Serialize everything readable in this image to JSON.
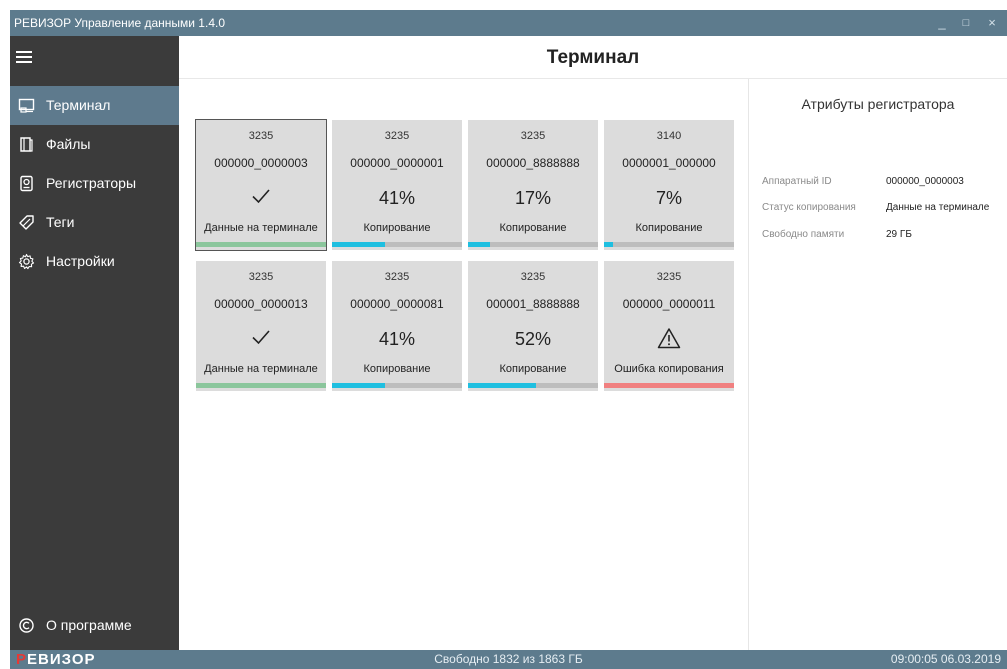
{
  "window": {
    "title": "РЕВИЗОР Управление данными 1.4.0",
    "controls": [
      "_",
      "□",
      "×"
    ]
  },
  "sidebar": {
    "items": [
      {
        "label": "Терминал",
        "icon": "terminal-icon",
        "active": true
      },
      {
        "label": "Файлы",
        "icon": "files-icon",
        "active": false
      },
      {
        "label": "Регистраторы",
        "icon": "recorder-icon",
        "active": false
      },
      {
        "label": "Теги",
        "icon": "tag-icon",
        "active": false
      },
      {
        "label": "Настройки",
        "icon": "gear-icon",
        "active": false
      }
    ],
    "about": {
      "label": "О программе",
      "icon": "copyright-icon"
    }
  },
  "header": {
    "title": "Терминал"
  },
  "devices": [
    {
      "number": "3235",
      "id": "000000_0000003",
      "progress_text": "",
      "indicator": "check-icon",
      "status": "Данные на терминале",
      "progress": 1.0,
      "bar_color": "#8bc69c",
      "selected": true
    },
    {
      "number": "3235",
      "id": "000000_0000001",
      "progress_text": "41%",
      "indicator": "",
      "status": "Копирование",
      "progress": 0.41,
      "bar_color": "#1fbfe0",
      "selected": false
    },
    {
      "number": "3235",
      "id": "000000_8888888",
      "progress_text": "17%",
      "indicator": "",
      "status": "Копирование",
      "progress": 0.17,
      "bar_color": "#1fbfe0",
      "selected": false
    },
    {
      "number": "3140",
      "id": "0000001_000000",
      "progress_text": "7%",
      "indicator": "",
      "status": "Копирование",
      "progress": 0.07,
      "bar_color": "#1fbfe0",
      "selected": false
    },
    {
      "number": "3235",
      "id": "000000_0000013",
      "progress_text": "",
      "indicator": "check-icon",
      "status": "Данные на терминале",
      "progress": 1.0,
      "bar_color": "#8bc69c",
      "selected": false
    },
    {
      "number": "3235",
      "id": "000000_0000081",
      "progress_text": "41%",
      "indicator": "",
      "status": "Копирование",
      "progress": 0.41,
      "bar_color": "#1fbfe0",
      "selected": false
    },
    {
      "number": "3235",
      "id": "000001_8888888",
      "progress_text": "52%",
      "indicator": "",
      "status": "Копирование",
      "progress": 0.52,
      "bar_color": "#1fbfe0",
      "selected": false
    },
    {
      "number": "3235",
      "id": "000000_0000011",
      "progress_text": "",
      "indicator": "warning-icon",
      "status": "Ошибка копирования",
      "progress": 1.0,
      "bar_color": "#f08080",
      "selected": false
    }
  ],
  "attributes": {
    "title": "Атрибуты регистратора",
    "rows": [
      {
        "key": "Аппаратный ID",
        "value": "000000_0000003"
      },
      {
        "key": "Статус копирования",
        "value": "Данные на терминале"
      },
      {
        "key": "Свободно памяти",
        "value": "29 ГБ"
      }
    ]
  },
  "statusbar": {
    "brand_first": "Р",
    "brand_rest": "ЕВИЗОР",
    "free_space": "Свободно 1832 из 1863 ГБ",
    "datetime": "09:00:05 06.03.2019"
  },
  "colors": {
    "accent": "#5d7b8d",
    "sidebar": "#3b3b3b",
    "card": "#dcdcdc"
  }
}
